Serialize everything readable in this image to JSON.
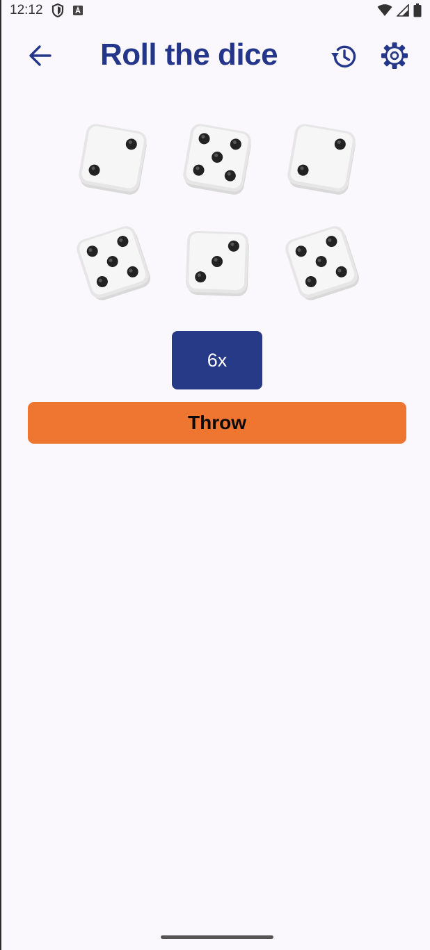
{
  "status_bar": {
    "time": "12:12"
  },
  "app_bar": {
    "title": "Roll the dice"
  },
  "dice": [
    {
      "value": 2,
      "rotate": 10
    },
    {
      "value": 5,
      "rotate": 10
    },
    {
      "value": 2,
      "rotate": 10
    },
    {
      "value": 5,
      "rotate": -18
    },
    {
      "value": 3,
      "rotate": 2
    },
    {
      "value": 5,
      "rotate": -18
    }
  ],
  "controls": {
    "count_label": "6x",
    "throw_label": "Throw"
  },
  "colors": {
    "primary": "#24368a",
    "count_button": "#263a88",
    "throw_button": "#ee7630",
    "background": "#faf7fd"
  },
  "icons": {
    "back": "arrow-left-icon",
    "history": "history-icon",
    "settings": "gear-icon"
  }
}
